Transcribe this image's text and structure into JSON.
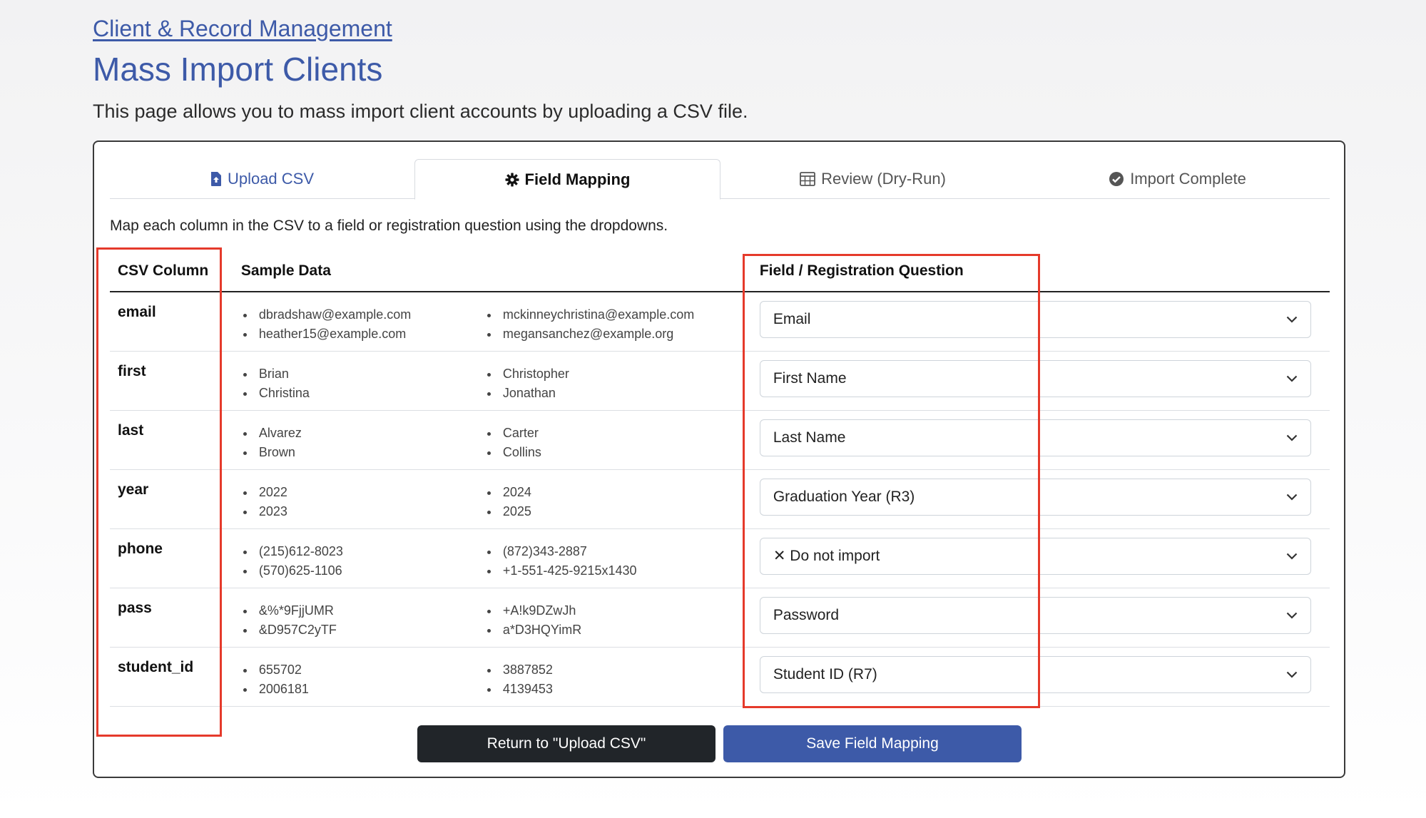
{
  "breadcrumb": "Client & Record Management",
  "page_title": "Mass Import Clients",
  "description": "This page allows you to mass import client accounts by uploading a CSV file.",
  "tabs": [
    {
      "label": "Upload CSV",
      "icon": "file-upload-icon"
    },
    {
      "label": "Field Mapping",
      "icon": "gear-icon"
    },
    {
      "label": "Review (Dry-Run)",
      "icon": "table-icon"
    },
    {
      "label": "Import Complete",
      "icon": "check-circle-icon"
    }
  ],
  "instructions": "Map each column in the CSV to a field or registration question using the dropdowns.",
  "table": {
    "headers": {
      "csv_column": "CSV Column",
      "sample_data": "Sample Data",
      "field": "Field / Registration Question"
    },
    "rows": [
      {
        "column": "email",
        "samples": [
          "dbradshaw@example.com",
          "heather15@example.com",
          "mckinneychristina@example.com",
          "megansanchez@example.org"
        ],
        "field": "Email"
      },
      {
        "column": "first",
        "samples": [
          "Brian",
          "Christina",
          "Christopher",
          "Jonathan"
        ],
        "field": "First Name"
      },
      {
        "column": "last",
        "samples": [
          "Alvarez",
          "Brown",
          "Carter",
          "Collins"
        ],
        "field": "Last Name"
      },
      {
        "column": "year",
        "samples": [
          "2022",
          "2023",
          "2024",
          "2025"
        ],
        "field": "Graduation Year (R3)"
      },
      {
        "column": "phone",
        "samples": [
          "(215)612-8023",
          "(570)625-1106",
          "(872)343-2887",
          "+1-551-425-9215x1430"
        ],
        "field": "✕ Do not import"
      },
      {
        "column": "pass",
        "samples": [
          "&%*9FjjUMR",
          "&D957C2yTF",
          "+A!k9DZwJh",
          "a*D3HQYimR"
        ],
        "field": "Password"
      },
      {
        "column": "student_id",
        "samples": [
          "655702",
          "2006181",
          "3887852",
          "4139453"
        ],
        "field": "Student ID (R7)"
      }
    ]
  },
  "buttons": {
    "return_label": "Return to \"Upload CSV\"",
    "save_label": "Save Field Mapping"
  },
  "colors": {
    "accent": "#3d5aa8",
    "dark_button": "#212529",
    "highlight_box": "#e53a2b"
  }
}
